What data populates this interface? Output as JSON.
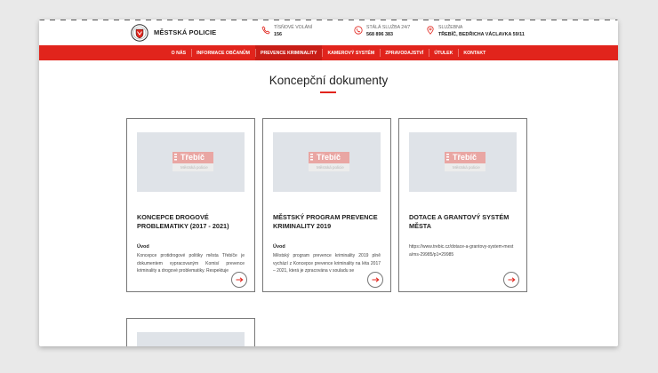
{
  "header": {
    "brand": "MĚSTSKÁ POLICIE",
    "contacts": [
      {
        "icon": "phone-icon",
        "label": "TÍSŇOVÉ VOLÁNÍ",
        "value": "156"
      },
      {
        "icon": "phone-24-icon",
        "label": "STÁLÁ SLUŽBA 24/7",
        "value": "568 896 383"
      },
      {
        "icon": "map-pin-icon",
        "label": "SLUŽEBNA",
        "value": "TŘEBÍČ, BEDŘICHA VÁCLAVKA 59/11"
      }
    ]
  },
  "nav": {
    "items": [
      {
        "label": "O NÁS"
      },
      {
        "label": "INFORMACE OBČANŮM"
      },
      {
        "label": "PREVENCE KRIMINALITY",
        "active": true
      },
      {
        "label": "KAMEROVÝ SYSTÉM"
      },
      {
        "label": "ZPRAVODAJSTVÍ"
      },
      {
        "label": "ÚTULEK"
      },
      {
        "label": "KONTAKT"
      }
    ]
  },
  "page": {
    "title": "Koncepční dokumenty"
  },
  "thumb_logo": {
    "name": "Třebíč",
    "tagline": "Městská policie"
  },
  "cards": [
    {
      "title": "KONCEPCE DROGOVÉ PROBLEMATIKY (2017 - 2021)",
      "subtitle": "Úvod",
      "body": "Koncepce protidrogové politiky města Třebíče je dokumentem vypracovaným Komisí prevence kriminality a drogové problematiky. Respektuje"
    },
    {
      "title": "MĚSTSKÝ PROGRAM PREVENCE KRIMINALITY 2019",
      "subtitle": "Úvod",
      "body": "Městský program prevence kriminality 2019 plně vychází z Koncepce prevence kriminality na léta 2017 – 2021, která je zpracována v souladu se"
    },
    {
      "title": "DOTACE A GRANTOVÝ SYSTÉM MĚSTA",
      "subtitle": "",
      "body": "https://www.trebic.cz/dotace-a-grantovy-system-mesta/ms-29985/p1=29985"
    }
  ],
  "colors": {
    "accent": "#e1241c",
    "accent_dark": "#c81d16",
    "thumb_bg": "#dfe3e8"
  }
}
